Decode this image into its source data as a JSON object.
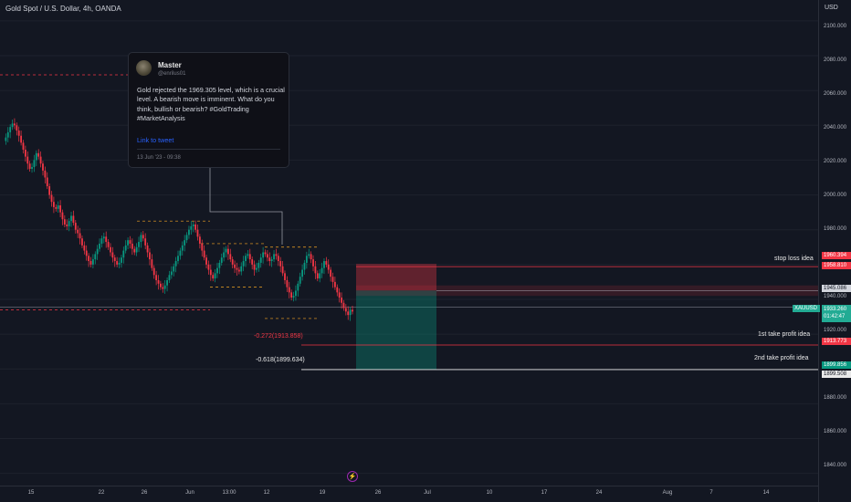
{
  "header": {
    "symbol_title": "Gold Spot / U.S. Dollar, 4h, OANDA",
    "currency": "USD"
  },
  "tweet": {
    "author": "Master",
    "handle": "@enrilus01",
    "text": "Gold rejected the 1969.305 level, which is a crucial level. A bearish move is imminent. What do you think, bullish or bearish? #GoldTrading #MarketAnalysis",
    "link_text": "Link to tweet",
    "date": "13 Jun '23 - 09:38"
  },
  "annotations": {
    "stop_loss": "stop loss idea",
    "tp1": "1st take profit idea",
    "tp2": "2nd take profit idea",
    "fib_272": "-0.272(1913.858)",
    "fib_618": "-0.618(1899.634)"
  },
  "price_axis": {
    "ticks": [
      "2100.000",
      "2080.000",
      "2060.000",
      "2040.000",
      "2020.000",
      "2000.000",
      "1980.000",
      "1940.000",
      "1920.000",
      "1880.000",
      "1860.000",
      "1840.000"
    ],
    "badges": {
      "sl1": "1960.394",
      "sl2": "1958.810",
      "entry": "1945.086",
      "symbol": "XAUUSD",
      "last": "1933.260",
      "countdown": "01:42:47",
      "tp1": "1913.773",
      "tp2a": "1899.856",
      "tp2b": "1899.508"
    }
  },
  "time_axis": {
    "ticks": [
      "15",
      "22",
      "26",
      "Jun",
      "13:00",
      "12",
      "19",
      "26",
      "Jul",
      "10",
      "17",
      "24",
      "Aug",
      "7",
      "14"
    ]
  },
  "chart_data": {
    "type": "candlestick",
    "symbol": "XAUUSD",
    "timeframe": "4h",
    "ylim": [
      1833,
      2112
    ],
    "price_levels": {
      "resistance": 1969.305,
      "stop_loss": [
        1960.394,
        1958.81
      ],
      "entry": 1945.086,
      "last": 1933.26,
      "tp1": 1913.773,
      "tp2": [
        1899.856,
        1899.508
      ],
      "fib_minus_0_272": 1913.858,
      "fib_minus_0_618": 1899.634
    },
    "ohlc_path": [
      2031,
      2033,
      2036,
      2039,
      2041,
      2040,
      2037,
      2034,
      2030,
      2026,
      2022,
      2018,
      2015,
      2016,
      2020,
      2024,
      2022,
      2018,
      2014,
      2010,
      2005,
      2000,
      1996,
      1993,
      1992,
      1994,
      1990,
      1986,
      1983,
      1982,
      1985,
      1988,
      1984,
      1980,
      1978,
      1975,
      1971,
      1968,
      1965,
      1962,
      1960,
      1963,
      1966,
      1969,
      1972,
      1975,
      1976,
      1973,
      1970,
      1967,
      1964,
      1962,
      1960,
      1961,
      1964,
      1968,
      1971,
      1974,
      1972,
      1969,
      1967,
      1970,
      1973,
      1977,
      1975,
      1971,
      1967,
      1963,
      1958,
      1954,
      1951,
      1949,
      1947,
      1946,
      1948,
      1951,
      1954,
      1956,
      1959,
      1962,
      1965,
      1968,
      1971,
      1974,
      1977,
      1980,
      1982,
      1983,
      1980,
      1976,
      1972,
      1968,
      1964,
      1960,
      1957,
      1954,
      1952,
      1955,
      1958,
      1961,
      1964,
      1967,
      1969,
      1966,
      1963,
      1960,
      1958,
      1957,
      1956,
      1959,
      1962,
      1965,
      1966,
      1963,
      1960,
      1957,
      1958,
      1961,
      1964,
      1967,
      1966,
      1964,
      1962,
      1963,
      1966,
      1965,
      1962,
      1959,
      1955,
      1951,
      1947,
      1944,
      1941,
      1942,
      1945,
      1949,
      1953,
      1957,
      1961,
      1965,
      1966,
      1963,
      1959,
      1955,
      1952,
      1955,
      1958,
      1962,
      1960,
      1957,
      1953,
      1950,
      1947,
      1944,
      1941,
      1938,
      1935,
      1933,
      1931,
      1934,
      1933
    ]
  }
}
